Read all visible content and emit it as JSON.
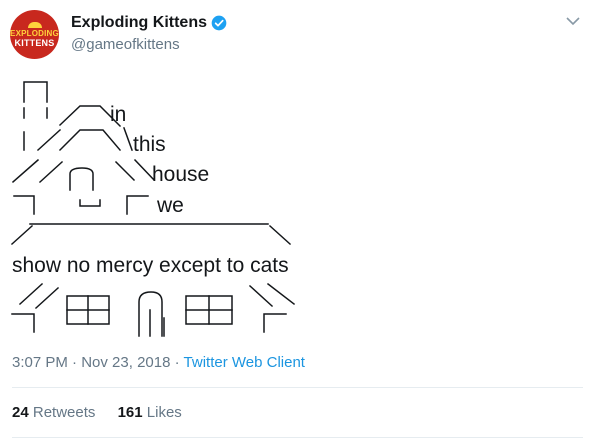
{
  "account": {
    "name": "Exploding Kittens",
    "handle": "@gameofkittens",
    "avatar_line1": "EXPLODING",
    "avatar_line2": "KITTENS",
    "verified": true
  },
  "tweet": {
    "word_in": "in",
    "word_this": "this",
    "word_house": "house",
    "word_we": "we",
    "main_line": "show no mercy except to cats"
  },
  "meta": {
    "time": "3:07 PM",
    "date": "Nov 23, 2018",
    "client": "Twitter Web Client",
    "separator": "·"
  },
  "stats": {
    "retweets_count": "24",
    "retweets_label": "Retweets",
    "likes_count": "161",
    "likes_label": "Likes"
  },
  "colors": {
    "brand_red": "#c8281e",
    "verified_blue": "#1da1f2",
    "link_blue": "#1b95e0",
    "secondary_text": "#657786"
  },
  "icons": [
    "verified-icon",
    "chevron-down-icon"
  ]
}
